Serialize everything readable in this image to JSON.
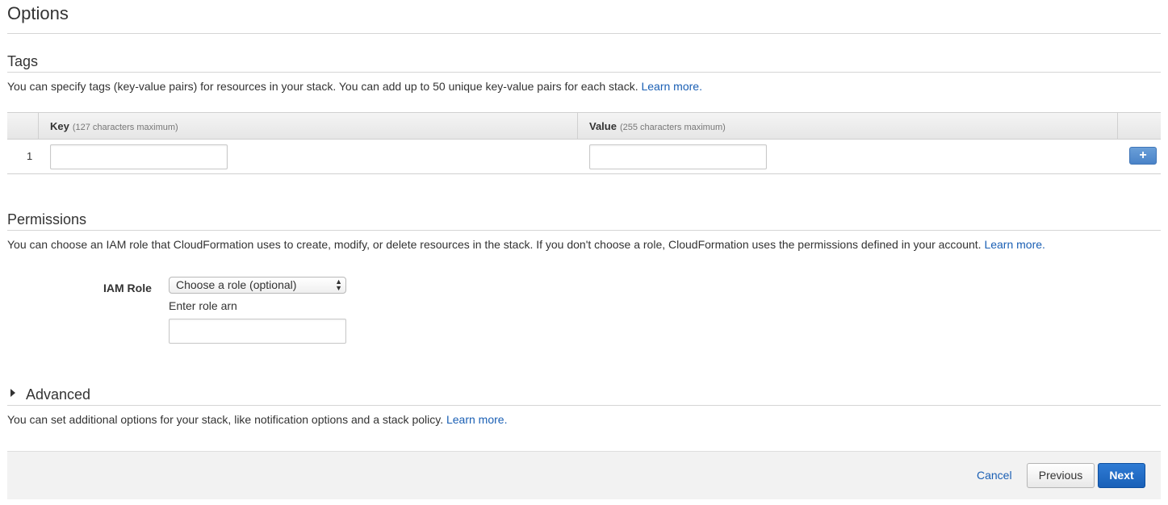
{
  "page": {
    "title": "Options"
  },
  "tags": {
    "title": "Tags",
    "description": "You can specify tags (key-value pairs) for resources in your stack. You can add up to 50 unique key-value pairs for each stack.",
    "learn_more": "Learn more.",
    "columns": {
      "key": {
        "label": "Key",
        "hint": "(127 characters maximum)"
      },
      "value": {
        "label": "Value",
        "hint": "(255 characters maximum)"
      }
    },
    "rows": [
      {
        "number": "1",
        "key": "",
        "value": ""
      }
    ],
    "add_button_icon": "plus-icon",
    "add_button_glyph": "+"
  },
  "permissions": {
    "title": "Permissions",
    "description": "You can choose an IAM role that CloudFormation uses to create, modify, or delete resources in the stack. If you don't choose a role, CloudFormation uses the permissions defined in your account.",
    "learn_more": "Learn more.",
    "iam_role_label": "IAM Role",
    "select_value": "Choose a role (optional)",
    "role_arn_label": "Enter role arn",
    "role_arn_value": ""
  },
  "advanced": {
    "title": "Advanced",
    "description": "You can set additional options for your stack, like notification options and a stack policy.",
    "learn_more": "Learn more."
  },
  "footer": {
    "cancel": "Cancel",
    "previous": "Previous",
    "next": "Next"
  },
  "colors": {
    "link": "#1a5fb4",
    "primary_button": "#1960b8",
    "add_button": "#4a83c8"
  }
}
